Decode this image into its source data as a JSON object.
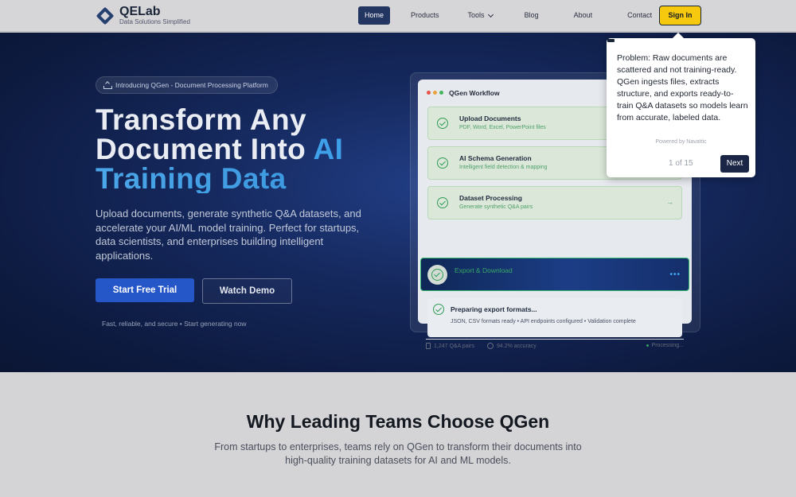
{
  "nav": {
    "brand": "QELab",
    "tagline": "Data Solutions Simplified",
    "links": [
      "Home",
      "Products",
      "Tools",
      "Blog",
      "About",
      "Contact"
    ],
    "sign_in": "Sign In"
  },
  "hero": {
    "badge": "Introducing QGen - Document Processing Platform",
    "title_line1": "Transform Any",
    "title_line2_a": "Document Into ",
    "title_line2_b": "AI",
    "title_line3": "Training Data",
    "subtitle": "Upload documents, generate synthetic Q&A datasets, and accelerate your AI/ML model training. Perfect for startups, data scientists, and enterprises building intelligent applications.",
    "primary_cta": "Start Free Trial",
    "secondary_cta": "Watch Demo",
    "fine_print": "Fast, reliable, and secure • Start generating now"
  },
  "workflow": {
    "title": "QGen Workflow",
    "window_dot_colors": [
      "#e5534b",
      "#e8a33d",
      "#45b35e"
    ],
    "steps": [
      {
        "title": "Upload Documents",
        "desc": "PDF, Word, Excel, PowerPoint files"
      },
      {
        "title": "AI Schema Generation",
        "desc": "Intelligent field detection & mapping"
      },
      {
        "title": "Dataset Processing",
        "desc": "Generate synthetic Q&A pairs",
        "arrow": "→"
      }
    ],
    "active_step": {
      "title": "Export & Download",
      "more": "•••"
    },
    "preparing": {
      "title": "Preparing export formats...",
      "desc": "JSON, CSV formats ready • API endpoints configured • Validation complete"
    },
    "stats": {
      "pairs": "1,247 Q&A pairs",
      "accuracy": "94.2% accuracy",
      "status": "Processing..."
    }
  },
  "tooltip": {
    "text": "Problem: Raw documents are scattered and not training-ready. QGen ingests files, extracts structure, and exports ready-to-train Q&A datasets so models learn from accurate, labeled data.",
    "powered_by": "Powered by Navattic",
    "counter": "1 of 15",
    "next": "Next"
  },
  "why": {
    "title": "Why Leading Teams Choose QGen",
    "subtitle": "From startups to enterprises, teams rely on QGen to transform their documents into high-quality training datasets for AI and ML models."
  },
  "colors": {
    "accent_blue": "#2557c8",
    "sign_in_yellow": "#f6c90e",
    "success_green": "#2f9e57"
  }
}
